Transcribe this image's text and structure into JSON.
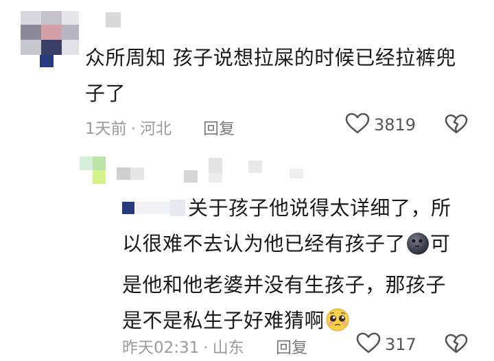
{
  "comment": {
    "username": "",
    "text": "众所周知 孩子说想拉屎的时候已经拉裤兜子了",
    "time": "1天前",
    "location": "河北",
    "reply_label": "回复",
    "like_count": "3819",
    "icons": [
      "heart-icon",
      "dislike-heart-icon"
    ]
  },
  "reply": {
    "username": "",
    "text_before": "关于孩子他说得太详细了，所以很难不去认为他已经有孩子了",
    "emoji_1": "moon-face-emoji",
    "text_after": "可是他和他老婆并没有生孩子，那孩子是不是私生子好难猜啊",
    "emoji_2": "pleading-face-emoji",
    "time": "昨天02:31",
    "location": "山东",
    "reply_label": "回复",
    "like_count": "317",
    "icons": [
      "heart-icon",
      "dislike-heart-icon"
    ]
  }
}
